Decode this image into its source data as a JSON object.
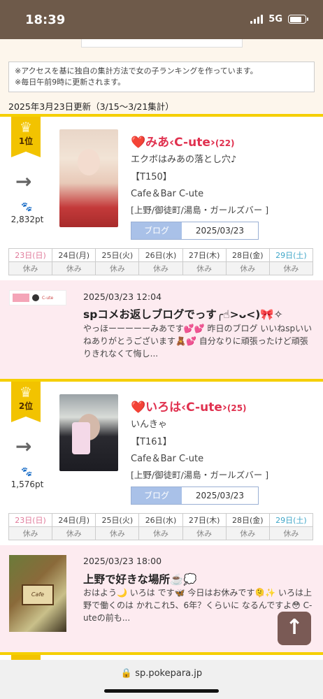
{
  "status_bar": {
    "time": "18:39",
    "network": "5G",
    "battery_level": 0.8
  },
  "notice": {
    "line1": "※アクセスを基に独自の集計方法で女の子ランキングを作っています。",
    "line2": "※毎日午前9時に更新されます。"
  },
  "update_date": "2025年3月23日更新（3/15〜3/21集計）",
  "rankings": [
    {
      "rank_label": "1位",
      "trend": "→",
      "points": "2,832pt",
      "name": "みあ‹C-ute›",
      "age": "(22)",
      "catchphrase": "エクボはみあの落とし穴♪",
      "tline": "【T150】",
      "shop": "Cafe＆Bar C-ute",
      "area": "[上野/御徒町/湯島・ガールズバー ]",
      "blog_label": "ブログ",
      "blog_date": "2025/03/23",
      "schedule_days": [
        "23日(日)",
        "24日(月)",
        "25日(火)",
        "26日(水)",
        "27日(木)",
        "28日(金)",
        "29日(土)"
      ],
      "schedule_status": [
        "休み",
        "休み",
        "休み",
        "休み",
        "休み",
        "休み",
        "休み"
      ],
      "blog_post": {
        "time": "2025/03/23 12:04",
        "title": "spコメお返しブログでっす╭☝︎>ᴗ<)🎀✧",
        "body": "やっほーーーーーみあです💕💕 昨日のブログ いいねspいいねありがとうございます🧸💕 自分なりに頑張ったけど頑張りきれなくて悔し..."
      }
    },
    {
      "rank_label": "2位",
      "trend": "→",
      "points": "1,576pt",
      "name": "いろは‹C-ute›",
      "age": "(25)",
      "catchphrase": "いんきゃ",
      "tline": "【T161】",
      "shop": "Cafe＆Bar C-ute",
      "area": "[上野/御徒町/湯島・ガールズバー ]",
      "blog_label": "ブログ",
      "blog_date": "2025/03/23",
      "schedule_days": [
        "23日(日)",
        "24日(月)",
        "25日(火)",
        "26日(水)",
        "27日(木)",
        "28日(金)",
        "29日(土)"
      ],
      "schedule_status": [
        "休み",
        "休み",
        "休み",
        "休み",
        "休み",
        "休み",
        "休み"
      ],
      "blog_post": {
        "time": "2025/03/23 18:00",
        "title": "上野で好きな場所☕️💭",
        "body": "おはよう🌙 いろは です🦋 今日はお休みです🫠✨ いろは上野で働くのは かれこれ5、6年？くらいに なるんですよ😳 C-uteの前も..."
      }
    }
  ],
  "scroll_top_label": "↑",
  "browser": {
    "url": "sp.pokepara.jp"
  },
  "colors": {
    "accent_yellow": "#f5cf00",
    "name_pink": "#e0314f",
    "blog_bg": "#fdebf0",
    "status_bar": "#6e5a4a"
  }
}
